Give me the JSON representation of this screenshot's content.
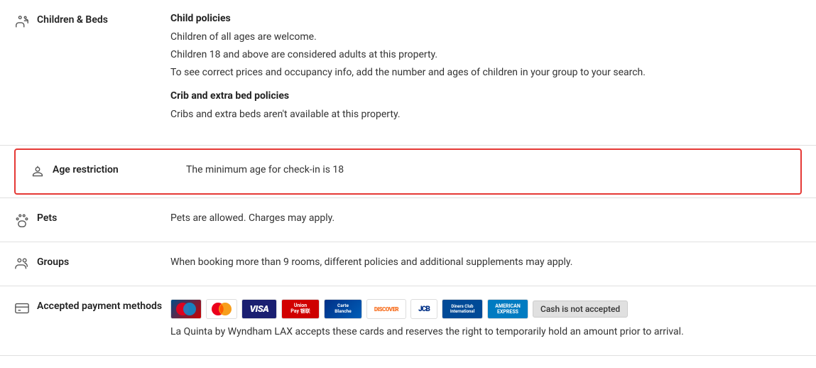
{
  "sections": {
    "children_beds": {
      "title": "Children & Beds",
      "child_policies_title": "Child policies",
      "child_policies": [
        "Children of all ages are welcome.",
        "Children 18 and above are considered adults at this property.",
        "To see correct prices and occupancy info, add the number and ages of children in your group to your search."
      ],
      "crib_title": "Crib and extra bed policies",
      "crib_text": "Cribs and extra beds aren't available at this property."
    },
    "age_restriction": {
      "title": "Age restriction",
      "text": "The minimum age for check-in is 18"
    },
    "pets": {
      "title": "Pets",
      "text": "Pets are allowed. Charges may apply."
    },
    "groups": {
      "title": "Groups",
      "text": "When booking more than 9 rooms, different policies and additional supplements may apply."
    },
    "payment": {
      "title": "Accepted payment methods",
      "cards": [
        {
          "name": "Maestro",
          "class": "card-maestro",
          "label": "Maestro"
        },
        {
          "name": "Mastercard",
          "class": "card-mastercard",
          "label": "MC"
        },
        {
          "name": "VISA",
          "class": "card-visa",
          "label": "VISA"
        },
        {
          "name": "UnionPay",
          "class": "card-unionpay",
          "label": "UnionPay 银联"
        },
        {
          "name": "Carte Blanche",
          "class": "card-carteblanche",
          "label": "Carte Blanche"
        },
        {
          "name": "Discover",
          "class": "card-discover",
          "label": "DISCOVER"
        },
        {
          "name": "JCB",
          "class": "card-jcb",
          "label": "JCB"
        },
        {
          "name": "Diners",
          "class": "card-diners",
          "label": "Diners Club Intl"
        },
        {
          "name": "Amex",
          "class": "card-amex",
          "label": "AMERICAN EXPRESS"
        }
      ],
      "cash_badge": "Cash is not accepted",
      "footnote": "La Quinta by Wyndham LAX accepts these cards and reserves the right to temporarily hold an amount prior to arrival."
    }
  }
}
